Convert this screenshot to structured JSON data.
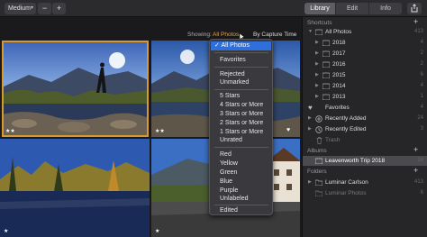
{
  "toolbar": {
    "zoom_value": "Medium",
    "zoom_minus": "−",
    "zoom_plus": "+",
    "tabs": [
      "Library",
      "Edit",
      "Info"
    ],
    "active_tab": "Library"
  },
  "filter_bar": {
    "showing_label": "Showing:",
    "showing_value": "All Photos",
    "sort_label": "By Capture Time ⌄"
  },
  "thumbnails": [
    {
      "stars": "★★",
      "favorite": false
    },
    {
      "stars": "★★",
      "favorite": true,
      "heart": "♥"
    },
    {
      "stars": "★",
      "favorite": false
    },
    {
      "stars": "★",
      "favorite": false
    }
  ],
  "filter_menu": {
    "checkmark": "✓",
    "items": [
      "All Photos",
      "Favorites",
      "Rejected",
      "Unmarked",
      "5 Stars",
      "4 Stars or More",
      "3 Stars or More",
      "2 Stars or More",
      "1 Stars or More",
      "Unrated",
      "Red",
      "Yellow",
      "Green",
      "Blue",
      "Purple",
      "Unlabeled",
      "Edited"
    ]
  },
  "sidebar": {
    "shortcuts_title": "Shortcuts",
    "add_symbol": "+",
    "shortcuts": [
      {
        "label": "All Photos",
        "count": "413"
      },
      {
        "label": "2018",
        "count": "4"
      },
      {
        "label": "2017",
        "count": "2"
      },
      {
        "label": "2016",
        "count": "2"
      },
      {
        "label": "2015",
        "count": "6"
      },
      {
        "label": "2014",
        "count": "4"
      },
      {
        "label": "2013",
        "count": "1"
      },
      {
        "label": "Favorites",
        "count": "4"
      },
      {
        "label": "Recently Added",
        "count": "24"
      },
      {
        "label": "Recently Edited",
        "count": "3"
      },
      {
        "label": "Trash",
        "count": ""
      }
    ],
    "albums_title": "Albums",
    "albums": [
      {
        "label": "Leavenworth Trip 2018",
        "count": "18"
      }
    ],
    "folders_title": "Folders",
    "folders": [
      {
        "label": "Luminar Carlson",
        "count": "413"
      },
      {
        "label": "Luminar Photos",
        "count": "6"
      }
    ]
  },
  "colors": {
    "accent_orange": "#d89a2e",
    "selection_blue": "#2f6fdc"
  }
}
